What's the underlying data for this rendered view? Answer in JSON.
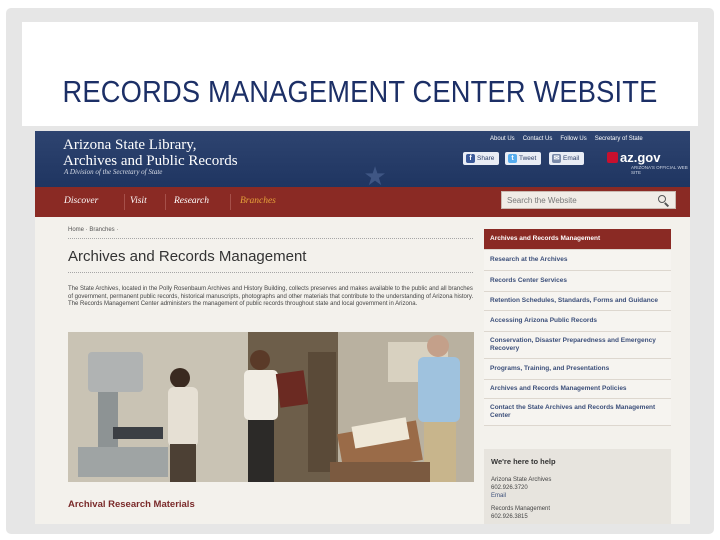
{
  "slide": {
    "title": "RECORDS MANAGEMENT CENTER WEBSITE"
  },
  "site": {
    "name_line1": "Arizona State Library,",
    "name_line2": "Archives and Public Records",
    "subtitle": "A Division of the Secretary of State",
    "top_links": [
      "About Us",
      "Contact Us",
      "Follow Us",
      "Secretary of State"
    ],
    "social": {
      "facebook": "Share",
      "twitter": "Tweet",
      "email": "Email"
    },
    "azgov": "az.gov",
    "azgov_sub": "ARIZONA'S OFFICIAL WEB SITE"
  },
  "nav": {
    "items": [
      "Discover",
      "Visit",
      "Research",
      "Branches"
    ],
    "search_placeholder": "Search the Website"
  },
  "page": {
    "breadcrumb": "Home · Branches ·",
    "title": "Archives and Records Management",
    "intro": "The State Archives, located in the Polly Rosenbaum Archives and History Building, collects preserves and makes available to the public and all branches of government, permanent public records, historical manuscripts, photographs and other materials that contribute to the understanding of Arizona history. The Records Management Center administers the management of public records throughout state and local government in Arizona.",
    "section_title": "Archival Research Materials"
  },
  "sidebar": {
    "items": [
      "Archives and Records Management",
      "Research at the Archives",
      "Records Center Services",
      "Retention Schedules, Standards, Forms and Guidance",
      "Accessing Arizona Public Records",
      "Conservation, Disaster Preparedness and Emergency Recovery",
      "Programs, Training, and Presentations",
      "Archives and Records Management Policies",
      "Contact the State Archives and Records Management Center"
    ]
  },
  "help": {
    "title": "We're here to help",
    "archives_name": "Arizona State Archives",
    "archives_phone": "602.926.3720",
    "archives_email": "Email",
    "records_name": "Records Management",
    "records_phone": "602.926.3815"
  },
  "colors": {
    "header_blue": "#1f3561",
    "nav_red": "#8a2a24",
    "slide_title": "#1c2f66"
  }
}
